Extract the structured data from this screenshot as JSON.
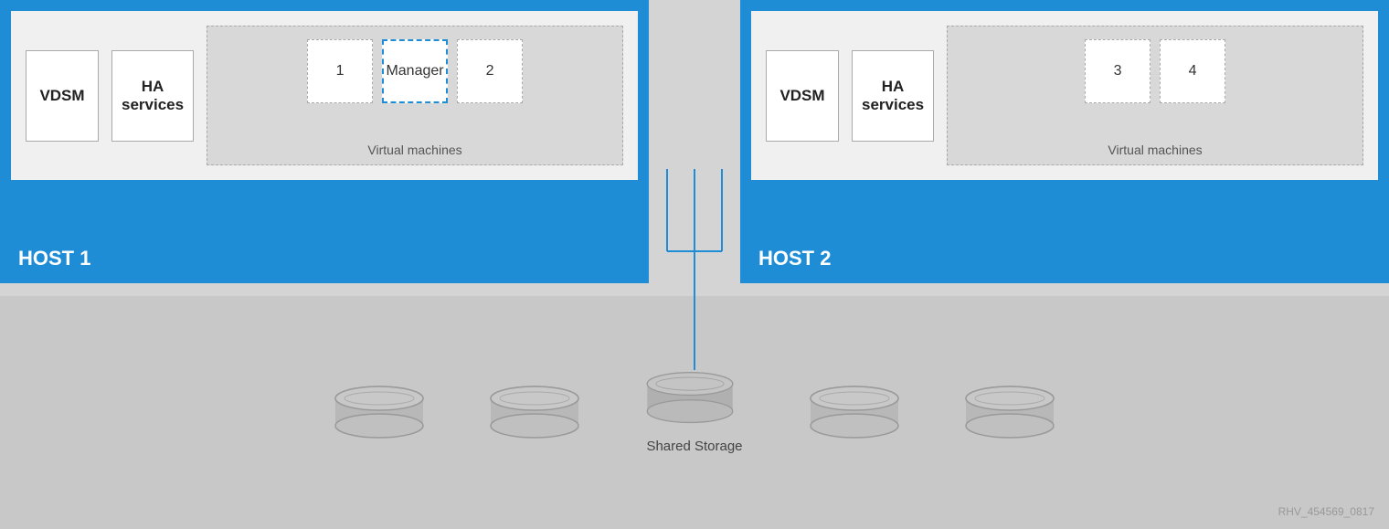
{
  "host1": {
    "label": "HOST 1",
    "vdsm": "VDSM",
    "ha_services": "HA\nservices",
    "vm1": "1",
    "vm_manager": "Manager",
    "vm2": "2",
    "vms_label": "Virtual machines"
  },
  "host2": {
    "label": "HOST 2",
    "vdsm": "VDSM",
    "ha_services": "HA\nservices",
    "vm3": "3",
    "vm4": "4",
    "vms_label": "Virtual machines"
  },
  "storage": {
    "shared_label": "Shared Storage",
    "disk_count": 5
  },
  "watermark": "RHV_454569_0817",
  "colors": {
    "blue": "#1f8dd6",
    "disk_color": "#b0b0b0"
  }
}
